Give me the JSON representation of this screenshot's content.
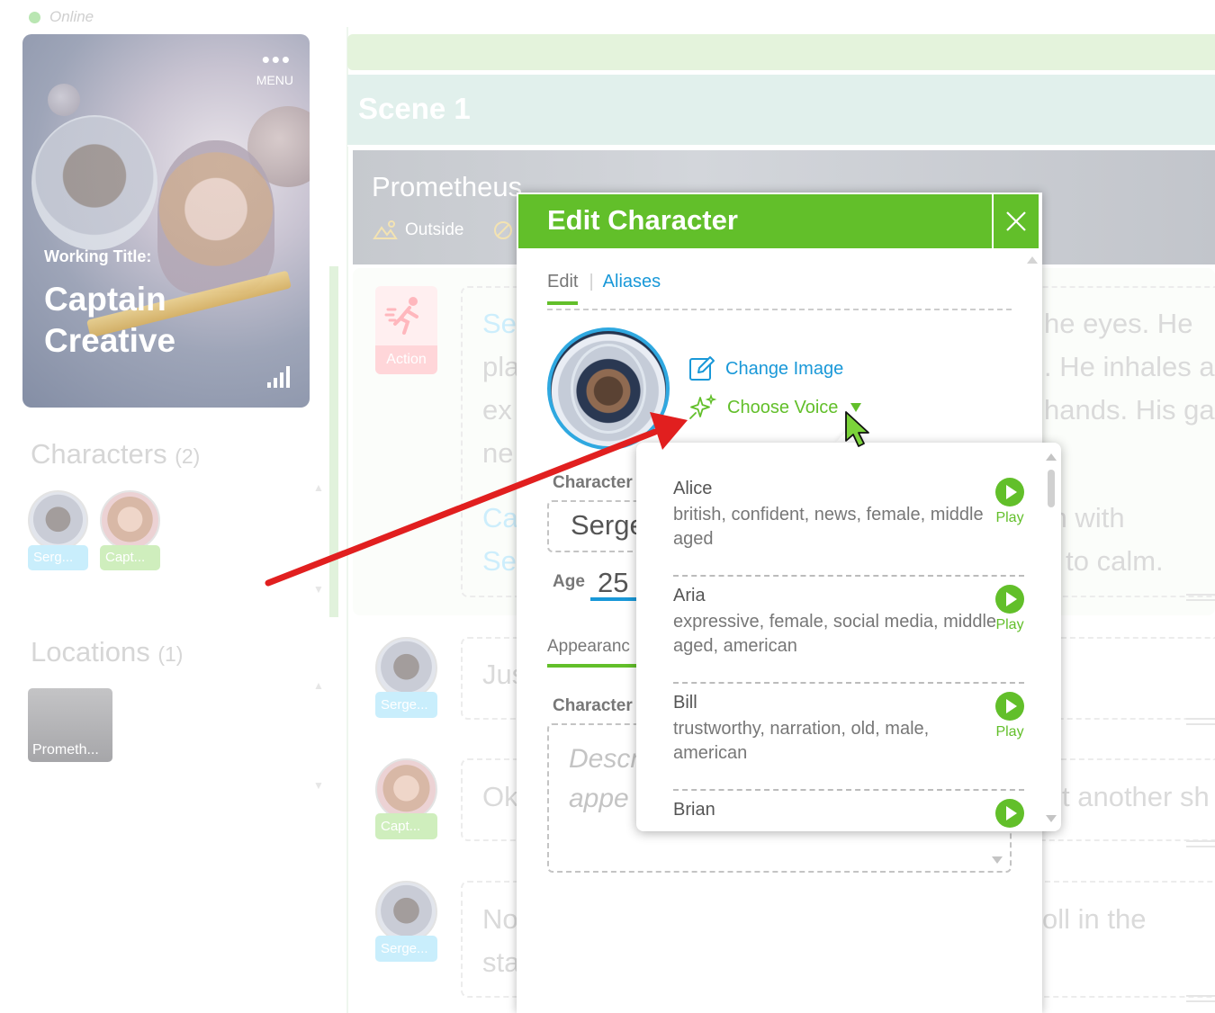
{
  "status": {
    "text": "Online"
  },
  "project": {
    "menu_label": "MENU",
    "working_title_label": "Working Title:",
    "title": "Captain Creative"
  },
  "sidebar": {
    "characters_title": "Characters",
    "characters_count": "(2)",
    "characters": [
      {
        "label": "Serg..."
      },
      {
        "label": "Capt..."
      }
    ],
    "locations_title": "Locations",
    "locations_count": "(1)",
    "locations": [
      {
        "label": "Prometh..."
      }
    ]
  },
  "scene": {
    "title": "Scene 1",
    "location_name": "Prometheus",
    "location_setting": "Outside",
    "action_label": "Action",
    "action_lines": [
      "Se",
      "pla",
      "ex",
      "ne",
      "",
      "Ca",
      "Se"
    ],
    "action_lines_right": [
      "he eyes. He",
      ". He inhales a",
      "hands. His ga",
      "",
      "m with",
      "s to calm."
    ],
    "dialogues": [
      {
        "speaker": "Serge...",
        "text": "Jus",
        "text_right": ""
      },
      {
        "speaker": "Capt...",
        "text": "Ok",
        "text_right": "t another sh"
      },
      {
        "speaker": "Serge...",
        "text": "No",
        "text_right": "oll in the",
        "text2": "sta"
      }
    ]
  },
  "modal": {
    "title": "Edit Character",
    "tabs": {
      "edit": "Edit",
      "aliases": "Aliases"
    },
    "change_image": "Change Image",
    "choose_voice": "Choose Voice",
    "character_name_label": "Character",
    "character_name_value": "Serge",
    "age_label": "Age",
    "age_value": "25",
    "appearance_tab": "Appearanc",
    "character_desc_label": "Character",
    "description_placeholder_1": "Descr",
    "description_placeholder_2": "appe"
  },
  "voices": [
    {
      "name": "Alice",
      "desc": "british, confident, news, female, middle aged",
      "play": "Play"
    },
    {
      "name": "Aria",
      "desc": "expressive, female, social media, middle aged, american",
      "play": "Play"
    },
    {
      "name": "Bill",
      "desc": "trustworthy, narration, old, male, american",
      "play": "Play"
    },
    {
      "name": "Brian",
      "desc": "",
      "play": "Play"
    }
  ],
  "colors": {
    "accent_green": "#62bf2a",
    "link_blue": "#1998d8",
    "arrow_red": "#e11f1f"
  }
}
